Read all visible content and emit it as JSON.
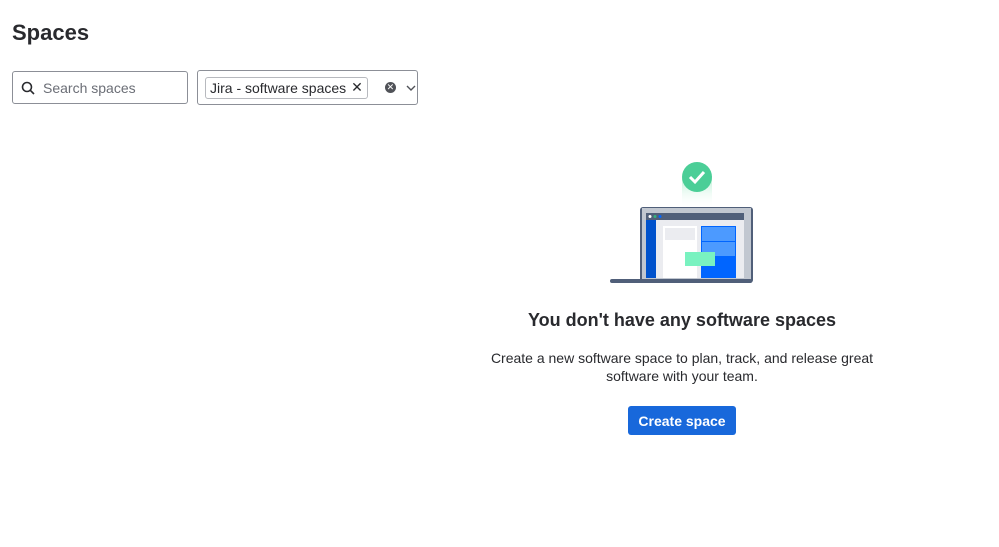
{
  "page": {
    "title": "Spaces"
  },
  "search": {
    "placeholder": "Search spaces"
  },
  "filter": {
    "selected": "Jira - software spaces"
  },
  "empty_state": {
    "title": "You don't have any software spaces",
    "description": "Create a new software space to plan, track, and release great software with your team.",
    "button": "Create space"
  },
  "colors": {
    "primary": "#1868db",
    "success": "#4bce97"
  }
}
